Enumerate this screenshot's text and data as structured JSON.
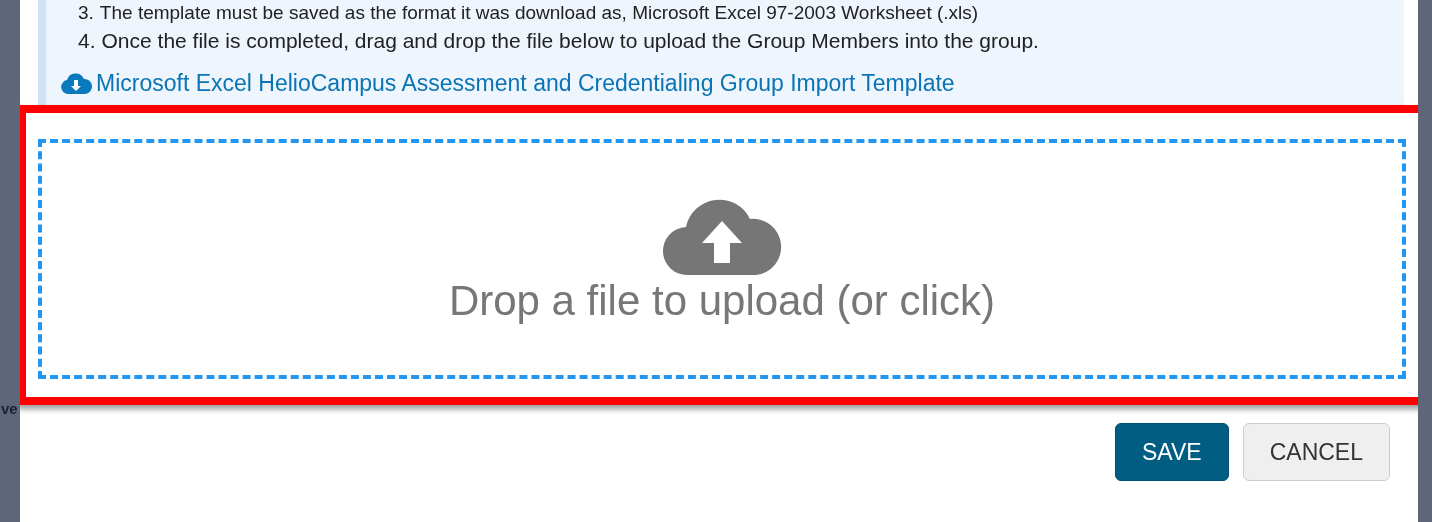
{
  "background": {
    "fragment": "ve"
  },
  "instructions": {
    "steps": [
      {
        "number": "3.",
        "text": "The template must be saved as the format it was download as, Microsoft Excel 97-2003 Worksheet (.xls)"
      },
      {
        "number": "4.",
        "text": "Once the file is completed, drag and drop the file below to upload the Group Members into the group."
      }
    ],
    "template_link": "Microsoft Excel HelioCampus Assessment and Credentialing Group Import Template"
  },
  "dropzone": {
    "label": "Drop a file to upload (or click)",
    "highlighted": true
  },
  "buttons": [
    {
      "label": "SAVE",
      "kind": "primary"
    },
    {
      "label": "CANCEL",
      "kind": "secondary"
    }
  ]
}
